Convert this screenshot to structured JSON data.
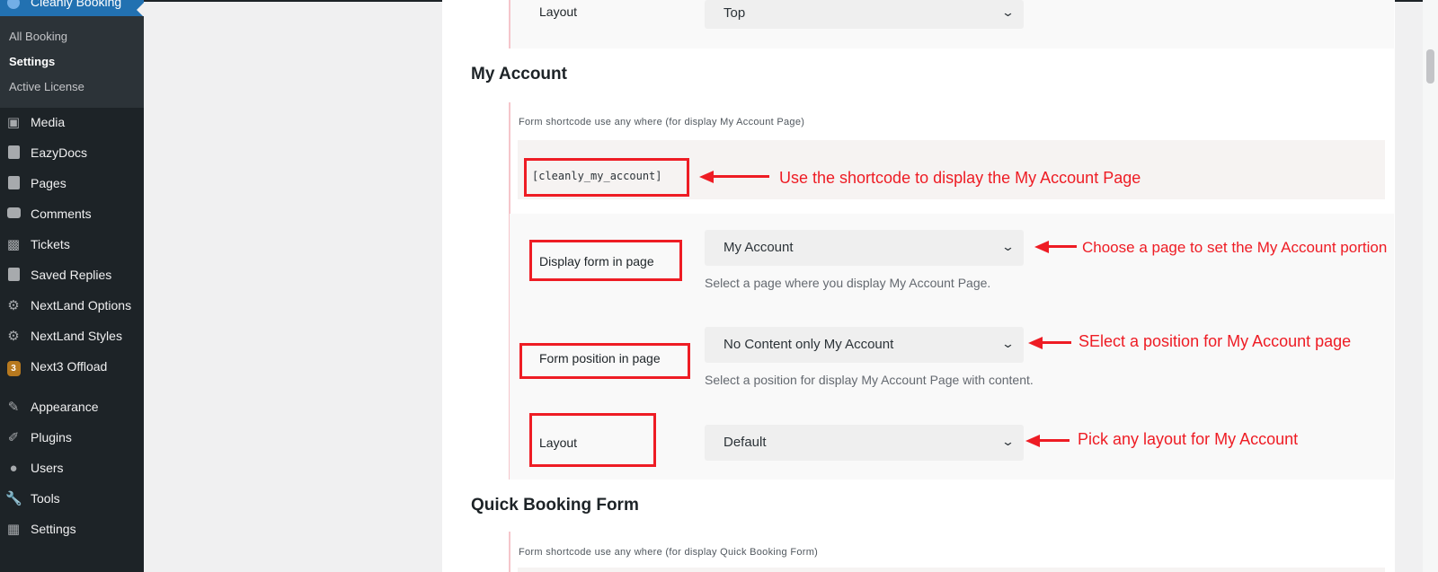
{
  "sidebar": {
    "current_menu": "Cleanly Booking",
    "submenu": [
      {
        "label": "All Booking",
        "active": false
      },
      {
        "label": "Settings",
        "active": true
      },
      {
        "label": "Active License",
        "active": false
      }
    ],
    "items": [
      {
        "label": "Media",
        "icon": "media-icon"
      },
      {
        "label": "EazyDocs",
        "icon": "document-icon"
      },
      {
        "label": "Pages",
        "icon": "pages-icon"
      },
      {
        "label": "Comments",
        "icon": "comment-icon"
      },
      {
        "label": "Tickets",
        "icon": "ticket-icon"
      },
      {
        "label": "Saved Replies",
        "icon": "book-icon"
      },
      {
        "label": "NextLand Options",
        "icon": "gear-icon"
      },
      {
        "label": "NextLand Styles",
        "icon": "gear-icon"
      },
      {
        "label": "Next3 Offload",
        "icon": "next3-logo-icon"
      },
      {
        "label": "Appearance",
        "icon": "brush-icon"
      },
      {
        "label": "Plugins",
        "icon": "plugin-icon"
      },
      {
        "label": "Users",
        "icon": "user-icon"
      },
      {
        "label": "Tools",
        "icon": "wrench-icon"
      },
      {
        "label": "Settings",
        "icon": "settings-icon"
      }
    ]
  },
  "top_section": {
    "layout_label": "Layout",
    "layout_value": "Top"
  },
  "my_account": {
    "title": "My Account",
    "hint": "Form shortcode use any where (for display My Account Page)",
    "shortcode": "[cleanly_my_account]",
    "display_form_label": "Display form in page",
    "display_form_value": "My Account",
    "display_form_desc": "Select a page where you display My Account Page.",
    "position_label": "Form position in page",
    "position_value": "No Content only My Account",
    "position_desc": "Select a position for display My Account Page with content.",
    "layout_label": "Layout",
    "layout_value": "Default"
  },
  "quick_booking": {
    "title": "Quick Booking Form",
    "hint": "Form shortcode use any where (for display Quick Booking Form)"
  },
  "annotations": {
    "shortcode": "Use the shortcode to display the My Account Page",
    "page": "Choose a page to set the My Account portion",
    "position": "SElect a position for My Account page",
    "layout": "Pick any layout for My Account"
  },
  "colors": {
    "annotation_red": "#ee1c24",
    "sidebar_bg": "#1d2327",
    "accent_blue": "#2271b1"
  }
}
